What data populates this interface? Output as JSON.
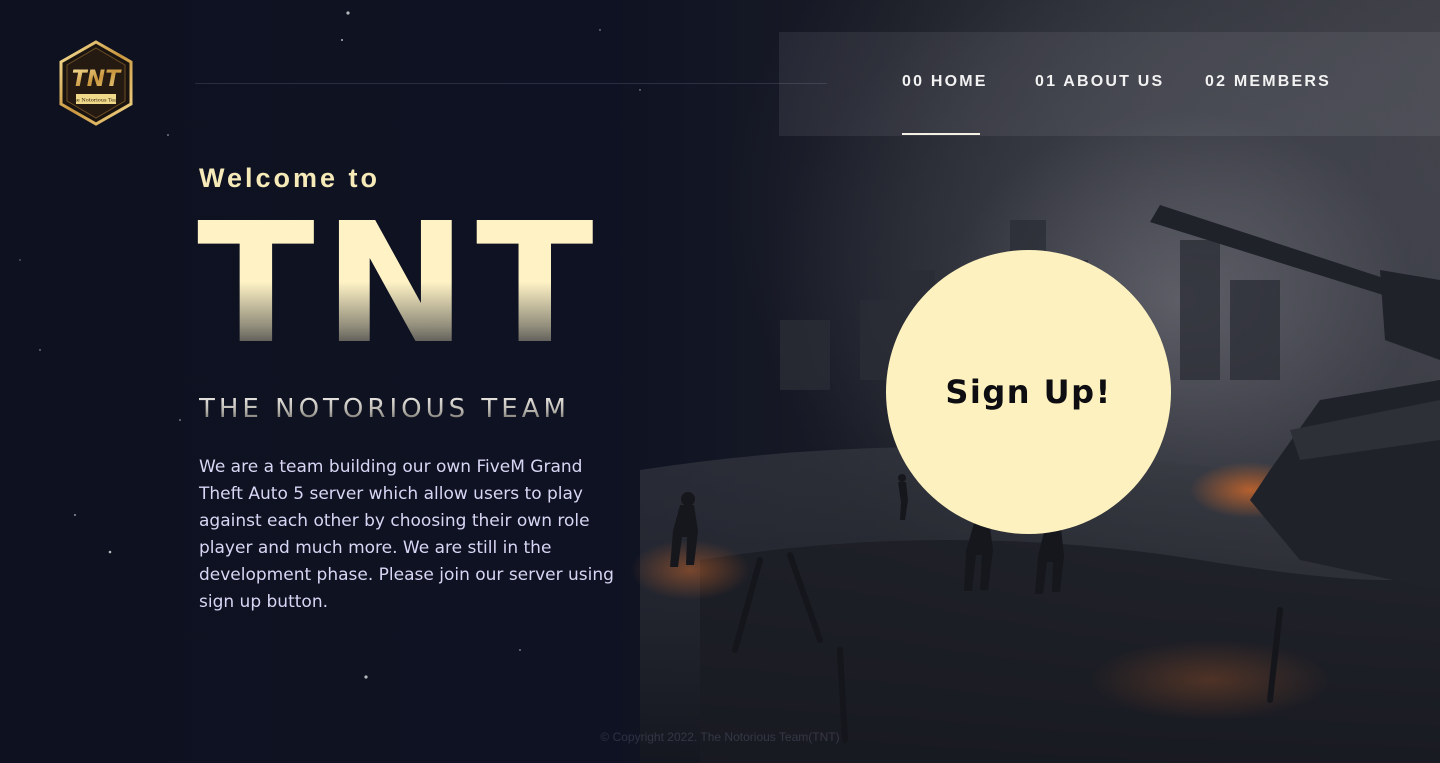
{
  "logo": {
    "text": "TNT",
    "tagline": "The Notorious Team"
  },
  "nav": {
    "items": [
      {
        "label": "00 HOME",
        "active": true
      },
      {
        "label": "01 ABOUT US",
        "active": false
      },
      {
        "label": "02 MEMBERS",
        "active": false
      }
    ]
  },
  "hero": {
    "welcome": "Welcome to",
    "title": "TNT",
    "subtitle": "THE NOTORIOUS TEAM",
    "description": "We are a team building our own FiveM Grand Theft Auto 5 server which allow users to play against each other by choosing their own role player and much more. We are still in the development phase. Please join our server using sign up button."
  },
  "cta": {
    "label": "Sign Up!"
  },
  "footer": {
    "copyright": "© Copyright 2022. The Notorious Team(TNT)"
  },
  "colors": {
    "background": "#0d1120",
    "accent": "#fdf2bf",
    "title_gold": "#f6eab8",
    "text": "#d8d6f4"
  },
  "icons": {
    "logo": "tnt-hexagon-logo"
  }
}
